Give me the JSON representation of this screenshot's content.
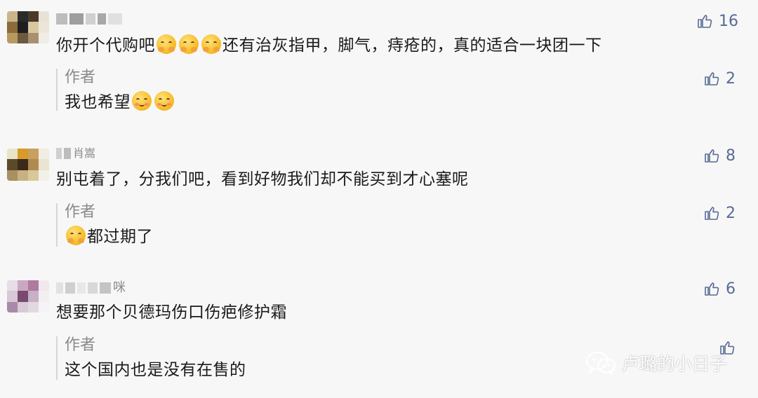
{
  "comments": [
    {
      "text_before": "你开个代购吧",
      "text_after": "还有治灰指甲，脚气，痔疮的，真的适合一块团一下",
      "likes": "16",
      "reply": {
        "label": "作者",
        "text": "我也希望",
        "likes": "2"
      }
    },
    {
      "nick_fragment": "肖嵩",
      "text": "别屯着了，分我们吧，看到好物我们却不能买到才心塞呢",
      "likes": "8",
      "reply": {
        "label": "作者",
        "text": "都过期了",
        "likes": "2"
      }
    },
    {
      "nick_fragment": "咪",
      "text": "想要那个贝德玛伤口伤疤修护霜",
      "likes": "6",
      "reply": {
        "label": "作者",
        "text": "这个国内也是没有在售的",
        "likes": ""
      }
    }
  ],
  "icons": {
    "like": "thumbs-up-icon",
    "emoji_hug": "hugging-face-icon",
    "emoji_smile": "smiling-face-icon",
    "watermark": "wechat-icon"
  },
  "watermark": {
    "text": "卢璐的小日子"
  },
  "colors": {
    "like": "#576b95",
    "background": "#f7f7f7",
    "reply_bar": "#d6d6d6"
  }
}
